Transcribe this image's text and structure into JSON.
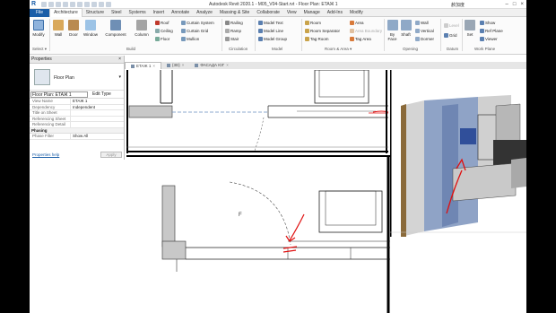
{
  "titlebar": {
    "title": "Autodesk Revit 2020.1 - M05_V04-Start.rvt - Floor Plan: ETAЖ 1",
    "user": "赦加度",
    "logo": "R"
  },
  "tabs": [
    "File",
    "Architecture",
    "Structure",
    "Steel",
    "Systems",
    "Insert",
    "Annotate",
    "Analyze",
    "Massing & Site",
    "Collaborate",
    "View",
    "Manage",
    "Add-Ins",
    "Modify"
  ],
  "ribbon": {
    "modify": "Modify",
    "select": "Select ▾",
    "build": {
      "label": "Build",
      "wall": "Wall",
      "door": "Door",
      "window": "Window",
      "component": "Component",
      "column": "Column",
      "roof": "Roof",
      "ceiling": "Ceiling",
      "floor": "Floor",
      "curtain_system": "Curtain System",
      "curtain_grid": "Curtain Grid",
      "mullion": "Mullion"
    },
    "circulation": {
      "label": "Circulation",
      "railing": "Railing",
      "ramp": "Ramp",
      "stair": "Stair"
    },
    "model": {
      "label": "Model",
      "model_text": "Model Text",
      "model_line": "Model Line",
      "model_group": "Model Group"
    },
    "room_area": {
      "label": "Room & Area ▾",
      "room": "Room",
      "room_separator": "Room Separator",
      "tag_room": "Tag Room",
      "area": "Area",
      "area_boundary": "Area Boundary",
      "tag_area": "Tag Area"
    },
    "opening": {
      "label": "Opening",
      "by_face": "By Face",
      "shaft": "Shaft",
      "wall": "Wall",
      "vertical": "Vertical",
      "dormer": "Dormer"
    },
    "datum": {
      "label": "Datum",
      "level": "Level",
      "grid": "Grid"
    },
    "work_plane": {
      "label": "Work Plane",
      "set": "Set",
      "show": "Show",
      "ref_plane": "Ref Plane",
      "viewer": "Viewer"
    }
  },
  "properties": {
    "title": "Properties",
    "close": "×",
    "type_name": "Floor Plan",
    "instance": "Floor Plan: ETAЖ 1",
    "edit_type": "Edit Type",
    "rows": [
      {
        "k": "View Name",
        "v": "ETAЖ 1"
      },
      {
        "k": "Dependency",
        "v": "Independent"
      },
      {
        "k": "Title on Sheet",
        "v": ""
      },
      {
        "k": "Referencing Sheet",
        "v": ""
      },
      {
        "k": "Referencing Detail",
        "v": ""
      }
    ],
    "section": "Phasing",
    "rows2": [
      {
        "k": "Phase Filter",
        "v": "Show All"
      }
    ],
    "help": "Properties help",
    "apply": "Apply"
  },
  "view_tabs": [
    {
      "label": "ETAЖ 1",
      "active": true
    },
    {
      "label": "{3D}",
      "active": false
    },
    {
      "label": "ФАСАДА ЮГ",
      "active": false
    }
  ],
  "colors": {
    "file_tab": "#1b5ea8",
    "annotation_red": "#e01010",
    "wall_fill": "#c8c8c8"
  }
}
